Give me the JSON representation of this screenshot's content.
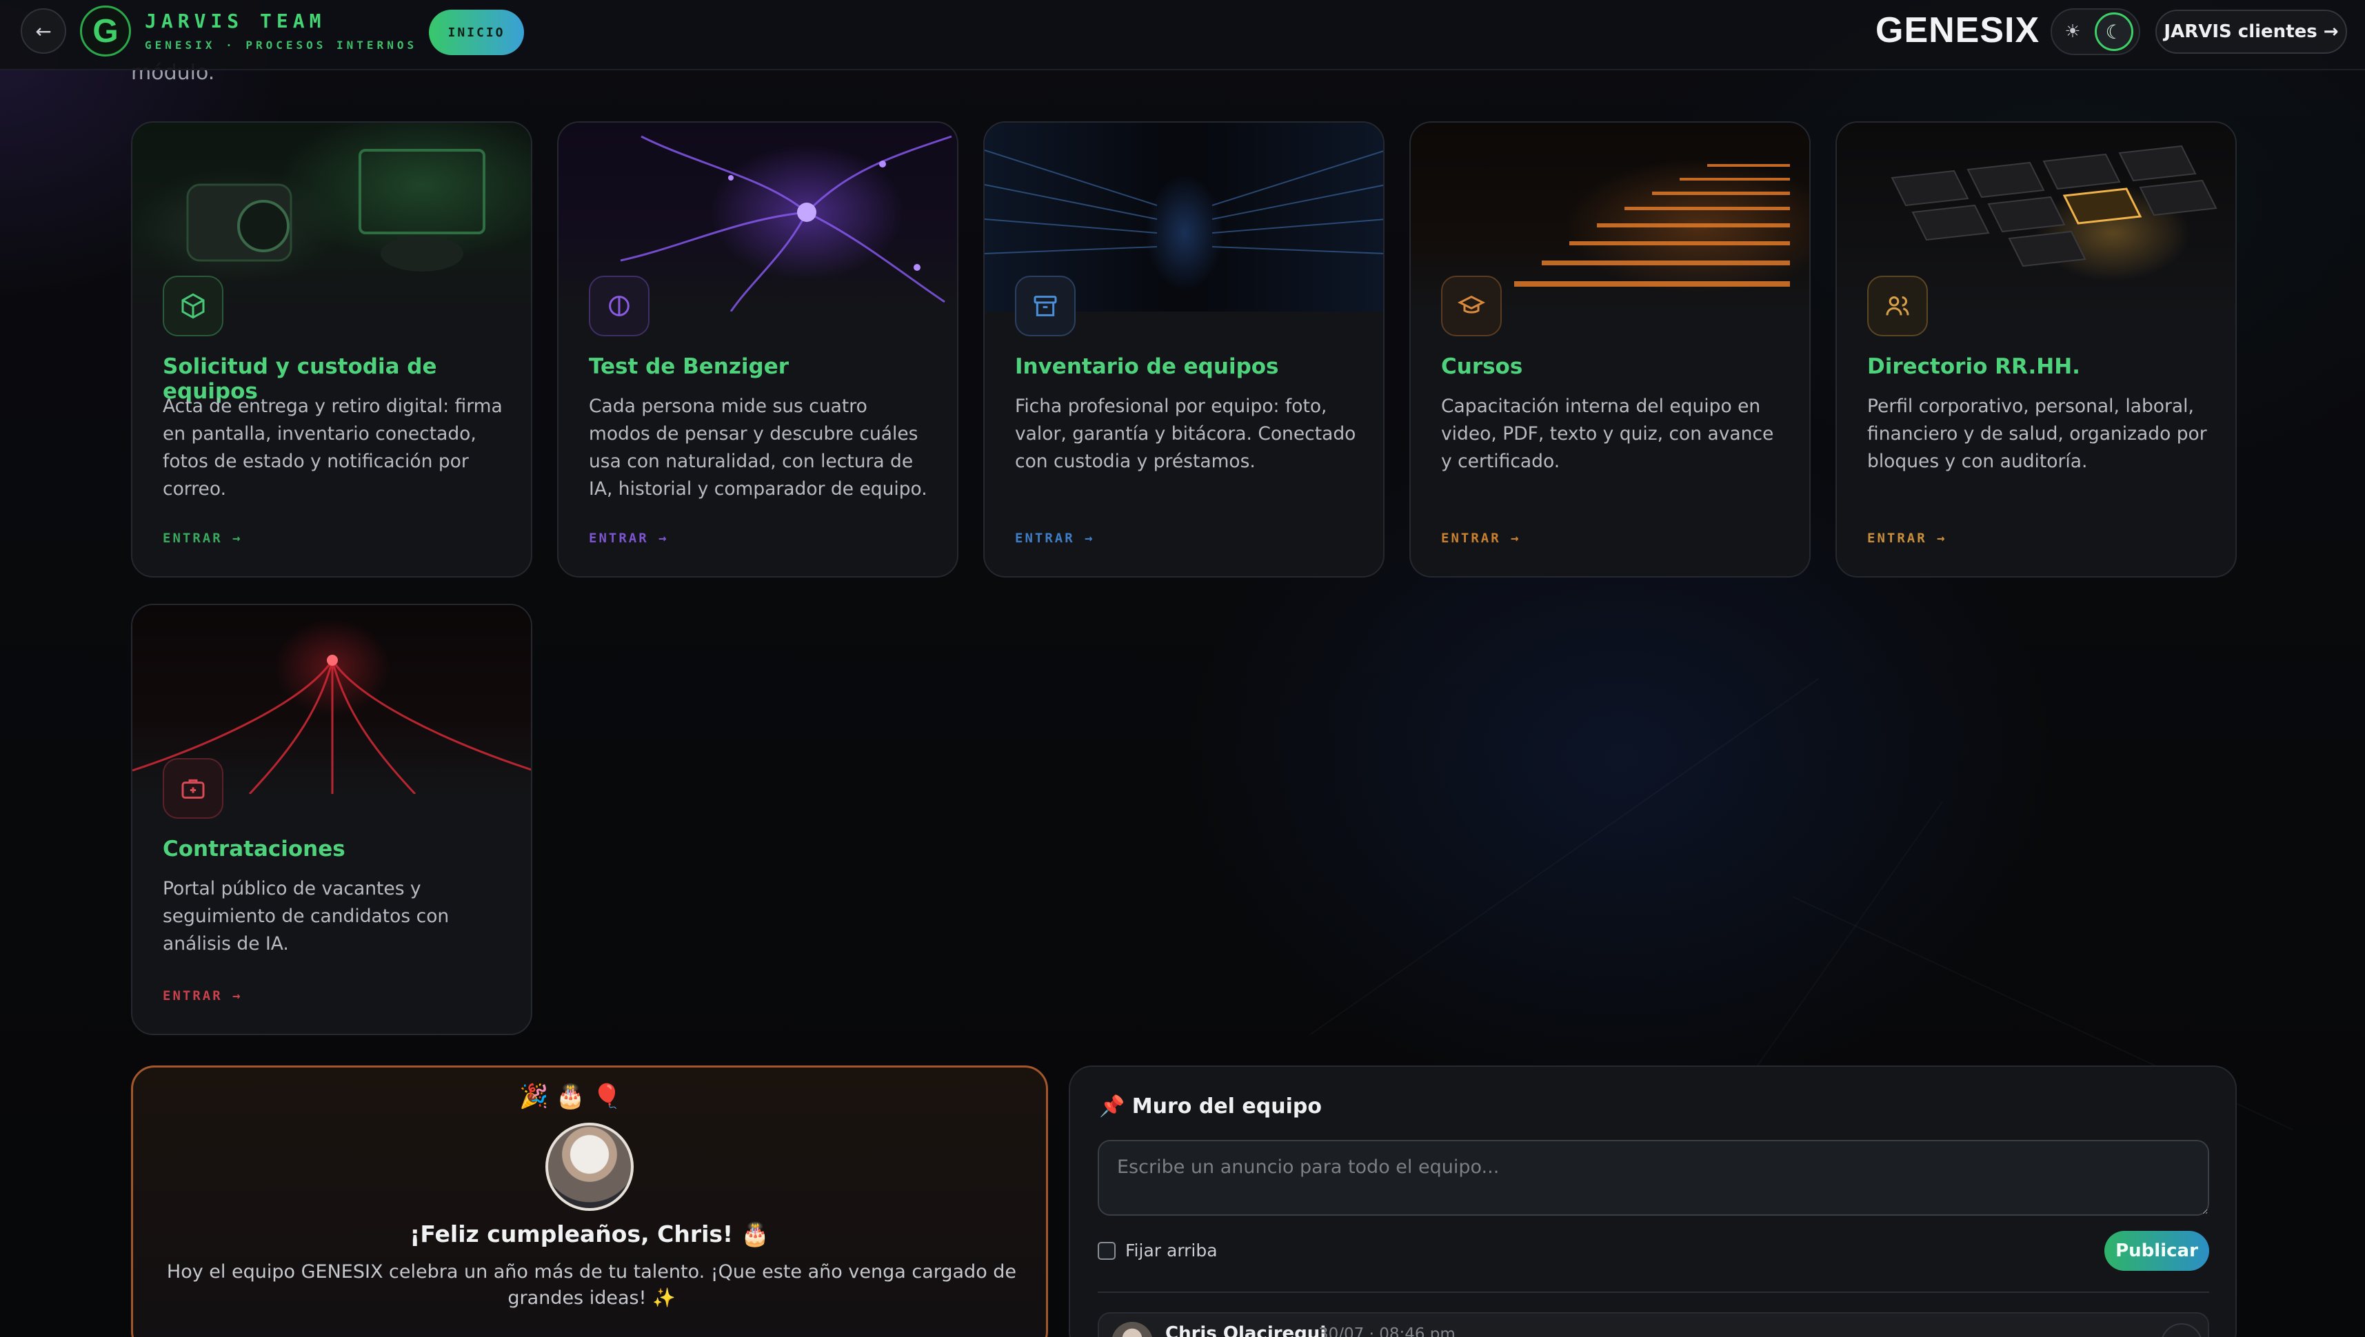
{
  "header": {
    "logo_letter": "G",
    "team_title": "JARVIS TEAM",
    "team_subtitle": "GENESIX · PROCESOS INTERNOS",
    "home_label": "INICIO",
    "brand": "GENESIX",
    "clients_button": "JARVIS clientes →",
    "theme_icons": [
      "sun-icon",
      "moon-icon"
    ]
  },
  "intro_tail": "módulo.",
  "modules": [
    {
      "title": "Solicitud y custodia de equipos",
      "description": "Acta de entrega y retiro digital: firma en pantalla, inventario conectado, fotos de estado y notificación por correo.",
      "cta": "ENTRAR →",
      "icon": "cube-icon",
      "accent": "#49c777"
    },
    {
      "title": "Test de Benziger",
      "description": "Cada persona mide sus cuatro modos de pensar y descubre cuáles usa con naturalidad, con lectura de IA, historial y comparador de equipo.",
      "cta": "ENTRAR →",
      "icon": "brain-icon",
      "accent": "#8a5be0"
    },
    {
      "title": "Inventario de equipos",
      "description": "Ficha profesional por equipo: foto, valor, garantía y bitácora. Conectado con custodia y préstamos.",
      "cta": "ENTRAR →",
      "icon": "archive-icon",
      "accent": "#4a8fd8"
    },
    {
      "title": "Cursos",
      "description": "Capacitación interna del equipo en video, PDF, texto y quiz, con avance y certificado.",
      "cta": "ENTRAR →",
      "icon": "graduation-cap-icon",
      "accent": "#d98a3c"
    },
    {
      "title": "Directorio RR.HH.",
      "description": "Perfil corporativo, personal, laboral, financiero y de salud, organizado por bloques y con auditoría.",
      "cta": "ENTRAR →",
      "icon": "users-icon",
      "accent": "#d9a04a"
    },
    {
      "title": "Contrataciones",
      "description": "Portal público de vacantes y seguimiento de candidatos con análisis de IA.",
      "cta": "ENTRAR →",
      "icon": "briefcase-plus-icon",
      "accent": "#d84a55"
    }
  ],
  "birthday": {
    "decorations": "🎉 🎂 🎈",
    "title": "¡Feliz cumpleaños, Chris! 🎂",
    "message": "Hoy el equipo GENESIX celebra un año más de tu talento. ¡Que este año venga cargado de grandes ideas! ✨"
  },
  "wall": {
    "title": "📌 Muro del equipo",
    "placeholder": "Escribe un anuncio para todo el equipo...",
    "pin_label": "Fijar arriba",
    "publish_label": "Publicar",
    "post_author": "Chris Olaciregui",
    "post_time": "30/07 · 08:46 pm"
  }
}
